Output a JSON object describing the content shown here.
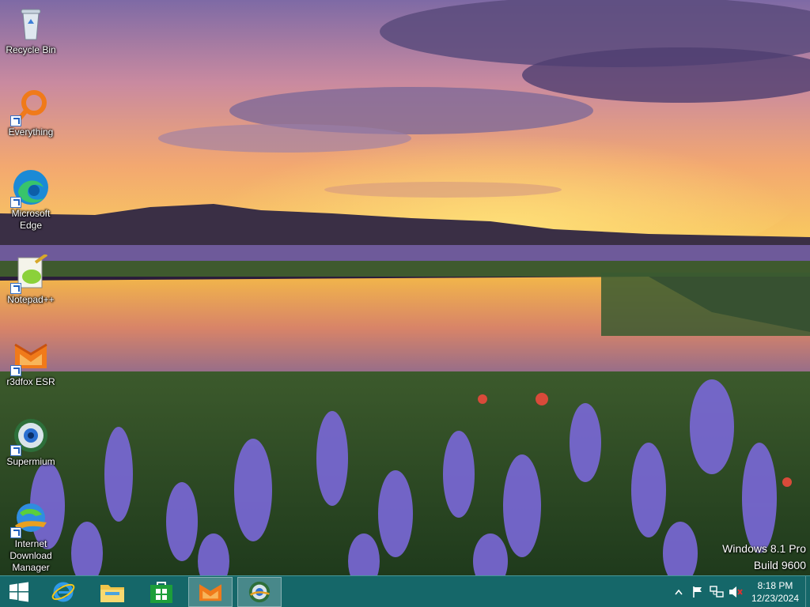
{
  "desktop": {
    "icons": [
      {
        "label": "Recycle Bin",
        "icon": "recycle-bin-icon",
        "shortcut": false
      },
      {
        "label": "Everything",
        "icon": "everything-search-icon",
        "shortcut": true
      },
      {
        "label": "Microsoft Edge",
        "icon": "edge-icon",
        "shortcut": true
      },
      {
        "label": "Notepad++",
        "icon": "notepad-plus-plus-icon",
        "shortcut": true
      },
      {
        "label": "r3dfox ESR",
        "icon": "r3dfox-icon",
        "shortcut": true
      },
      {
        "label": "Supermium",
        "icon": "supermium-icon",
        "shortcut": true
      },
      {
        "label": "Internet Download Manager",
        "icon": "idm-icon",
        "shortcut": true
      }
    ],
    "watermark": {
      "line1": "Windows 8.1 Pro",
      "line2": "Build 9600"
    }
  },
  "taskbar": {
    "start_icon": "windows-start-icon",
    "pinned": [
      {
        "name": "internet-explorer",
        "icon": "internet-explorer-icon",
        "active": false
      },
      {
        "name": "file-explorer",
        "icon": "folder-icon",
        "active": false
      },
      {
        "name": "store",
        "icon": "store-icon",
        "active": false
      },
      {
        "name": "r3dfox",
        "icon": "r3dfox-icon",
        "active": true
      },
      {
        "name": "supermium",
        "icon": "supermium-icon",
        "active": true
      }
    ],
    "tray": {
      "icons": [
        "show-hidden-icons-chevron",
        "action-center-flag-icon",
        "network-icon",
        "volume-muted-icon"
      ],
      "time": "8:18 PM",
      "date": "12/23/2024"
    }
  },
  "colors": {
    "taskbar": "#147272",
    "sky_top": "#8a6fa8",
    "horizon": "#f4b24a",
    "flowers": "#6d5fd0"
  }
}
